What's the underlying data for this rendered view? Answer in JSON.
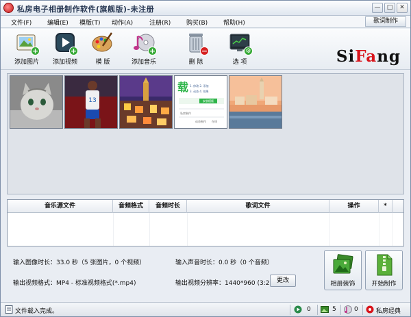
{
  "window": {
    "title": "私房电子相册制作软件(旗舰版)-未注册",
    "controls": [
      "—",
      "□",
      "✕"
    ]
  },
  "menu": {
    "items": [
      "文件(F)",
      "编辑(E)",
      "模版(T)",
      "动作(A)",
      "注册(R)",
      "购买(B)",
      "帮助(H)"
    ],
    "lyric_button": "歌词制作"
  },
  "toolbar": {
    "add_photo": "添加图片",
    "add_video": "添加视频",
    "template": "模 版",
    "add_music": "添加音乐",
    "delete": "删 除",
    "options": "选 项"
  },
  "logo": {
    "part1": "Si",
    "part2": "Fa",
    "part3": "ng"
  },
  "thumbnail_card": {
    "brand": "载",
    "line1": "1. 修改 2. 添加",
    "line2": "3. 动态 4. 效果",
    "button": "安装模版",
    "footer1": "私房制作",
    "footer2": "动态制作",
    "footer3": "在线"
  },
  "music_table": {
    "columns": [
      "音乐源文件",
      "音频格式",
      "音频时长",
      "歌词文件",
      "操作",
      "*"
    ]
  },
  "info": {
    "image_duration": "输入图像时长：33.0 秒（5 张图片，0 个视频）",
    "audio_duration": "输入声音时长：0.0 秒（0 个音频）",
    "output_format": "输出视频格式：MP4 - 标准视频格式(*.mp4)",
    "output_resolution": "输出视频分辨率：1440*960 (3:2)",
    "change_button": "更改",
    "decorate_button": "相册装饰",
    "start_button": "开始制作"
  },
  "status": {
    "message": "文件载入完成。",
    "count1": "0",
    "count2": "5",
    "count3": "0",
    "brand": "私房经典"
  },
  "colors": {
    "accent_red": "#d8141b",
    "add_green": "#35a935",
    "delete_red": "#d52020"
  }
}
